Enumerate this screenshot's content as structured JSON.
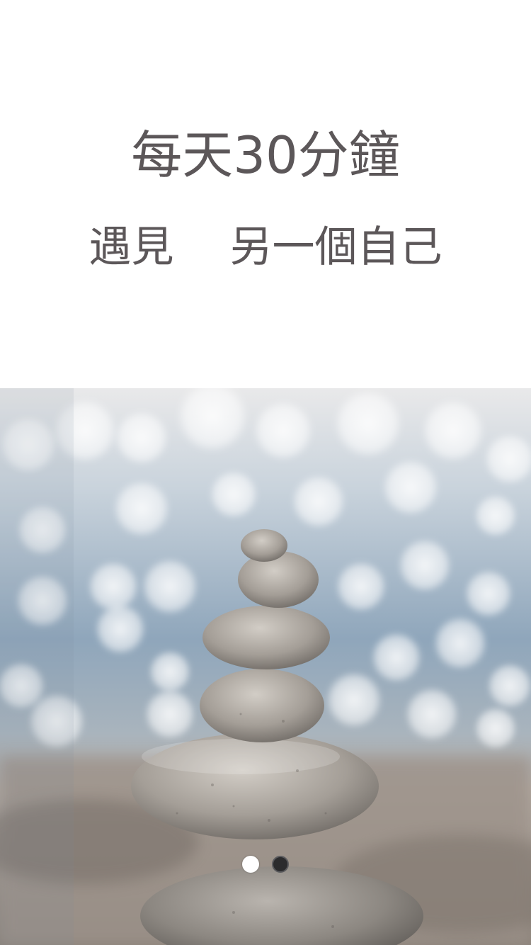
{
  "onboarding": {
    "headline": "每天30分鐘",
    "subline": "遇見　 另一個自己",
    "hero_image": "stacked-stones-bokeh",
    "pagination": {
      "count": 2,
      "active_index": 0,
      "active_color": "#ffffff",
      "inactive_color": "#2b2b2d"
    },
    "text_color": "#5c5759"
  }
}
